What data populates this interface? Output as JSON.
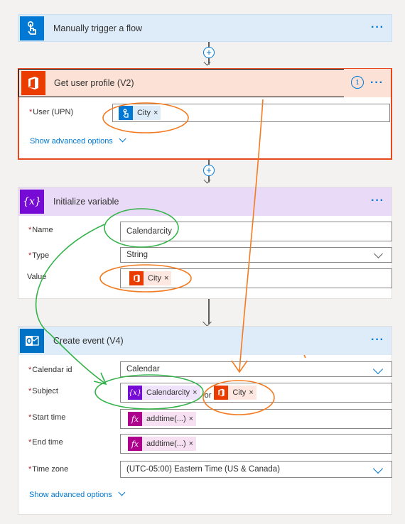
{
  "trigger": {
    "title": "Manually trigger a flow"
  },
  "profile": {
    "title": "Get user profile (V2)",
    "user_label": "User (UPN)",
    "user_token": "City",
    "advanced": "Show advanced options"
  },
  "initvar": {
    "title": "Initialize variable",
    "name_label": "Name",
    "name_value": "Calendarcity",
    "type_label": "Type",
    "type_value": "String",
    "value_label": "Value",
    "value_token": "City"
  },
  "event": {
    "title": "Create event (V4)",
    "calendar_label": "Calendar id",
    "calendar_value": "Calendar",
    "subject_label": "Subject",
    "subject_token1": "Calendarcity",
    "subject_sep": "or",
    "subject_token2": "City",
    "start_label": "Start time",
    "start_token": "addtime(...)",
    "end_label": "End time",
    "end_token": "addtime(...)",
    "tz_label": "Time zone",
    "tz_value": "(UTC-05:00) Eastern Time (US & Canada)",
    "advanced": "Show advanced options"
  },
  "glyphs": {
    "more": "···",
    "close": "×",
    "plus": "+",
    "info": "i",
    "variable": "{x}",
    "fx": "fx"
  },
  "colors": {
    "accent": "#0078d4",
    "trigger_icon": "#0078d4",
    "office": "#eb3c00",
    "variable": "#770bd6",
    "outlook": "#0072c6",
    "expression": "#ad008c",
    "annotation_orange": "#f47b20",
    "annotation_green": "#33b34a"
  }
}
